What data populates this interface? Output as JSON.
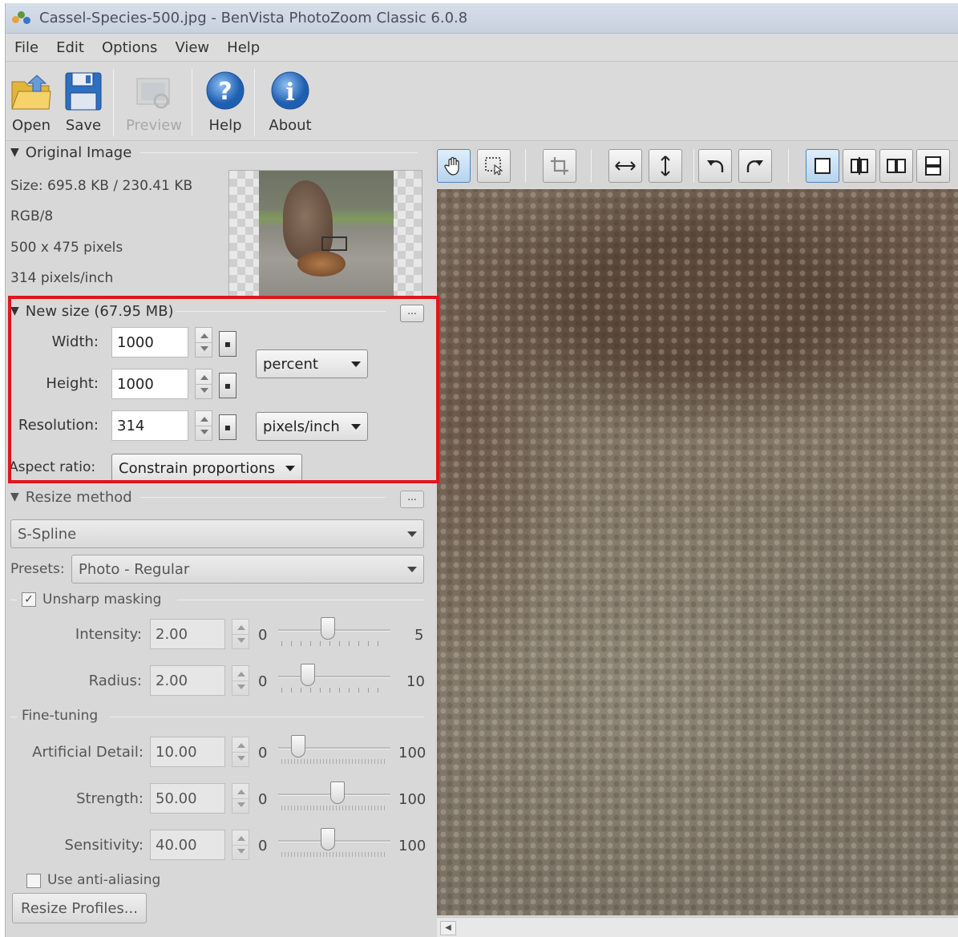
{
  "window": {
    "title": "Cassel-Species-500.jpg - BenVista PhotoZoom Classic 6.0.8"
  },
  "menu": [
    "File",
    "Edit",
    "Options",
    "View",
    "Help"
  ],
  "toolbar": {
    "open": "Open",
    "save": "Save",
    "preview": "Preview",
    "help": "Help",
    "about": "About"
  },
  "original_image": {
    "title": "Original Image",
    "size": "Size: 695.8 KB / 230.41 KB",
    "mode": "RGB/8",
    "dimensions": "500 x 475 pixels",
    "resolution": "314 pixels/inch"
  },
  "new_size": {
    "title": "New size (67.95 MB)",
    "more": "...",
    "width_label": "Width:",
    "width_value": "1000",
    "height_label": "Height:",
    "height_value": "1000",
    "resolution_label": "Resolution:",
    "resolution_value": "314",
    "size_unit": "percent",
    "resolution_unit": "pixels/inch",
    "aspect_label": "Aspect ratio:",
    "aspect_value": "Constrain proportions"
  },
  "resize_method": {
    "title": "Resize method",
    "more": "...",
    "method": "S-Spline",
    "presets_label": "Presets:",
    "preset": "Photo - Regular",
    "unsharp": {
      "label": "Unsharp masking",
      "checked": true,
      "intensity_label": "Intensity:",
      "intensity_value": "2.00",
      "intensity_min": "0",
      "intensity_max": "5",
      "intensity_level": 2.0,
      "radius_label": "Radius:",
      "radius_value": "2.00",
      "radius_min": "0",
      "radius_max": "10",
      "radius_level": 2.0
    },
    "fine_tuning": {
      "label": "Fine-tuning",
      "detail_label": "Artificial Detail:",
      "detail_value": "10.00",
      "detail_min": "0",
      "detail_max": "100",
      "detail_level": 10,
      "strength_label": "Strength:",
      "strength_value": "50.00",
      "strength_min": "0",
      "strength_max": "100",
      "strength_level": 50,
      "sensitivity_label": "Sensitivity:",
      "sensitivity_value": "40.00",
      "sensitivity_min": "0",
      "sensitivity_max": "100",
      "sensitivity_level": 40
    },
    "anti_alias": {
      "label": "Use anti-aliasing",
      "checked": false
    },
    "profiles_button": "Resize Profiles..."
  }
}
